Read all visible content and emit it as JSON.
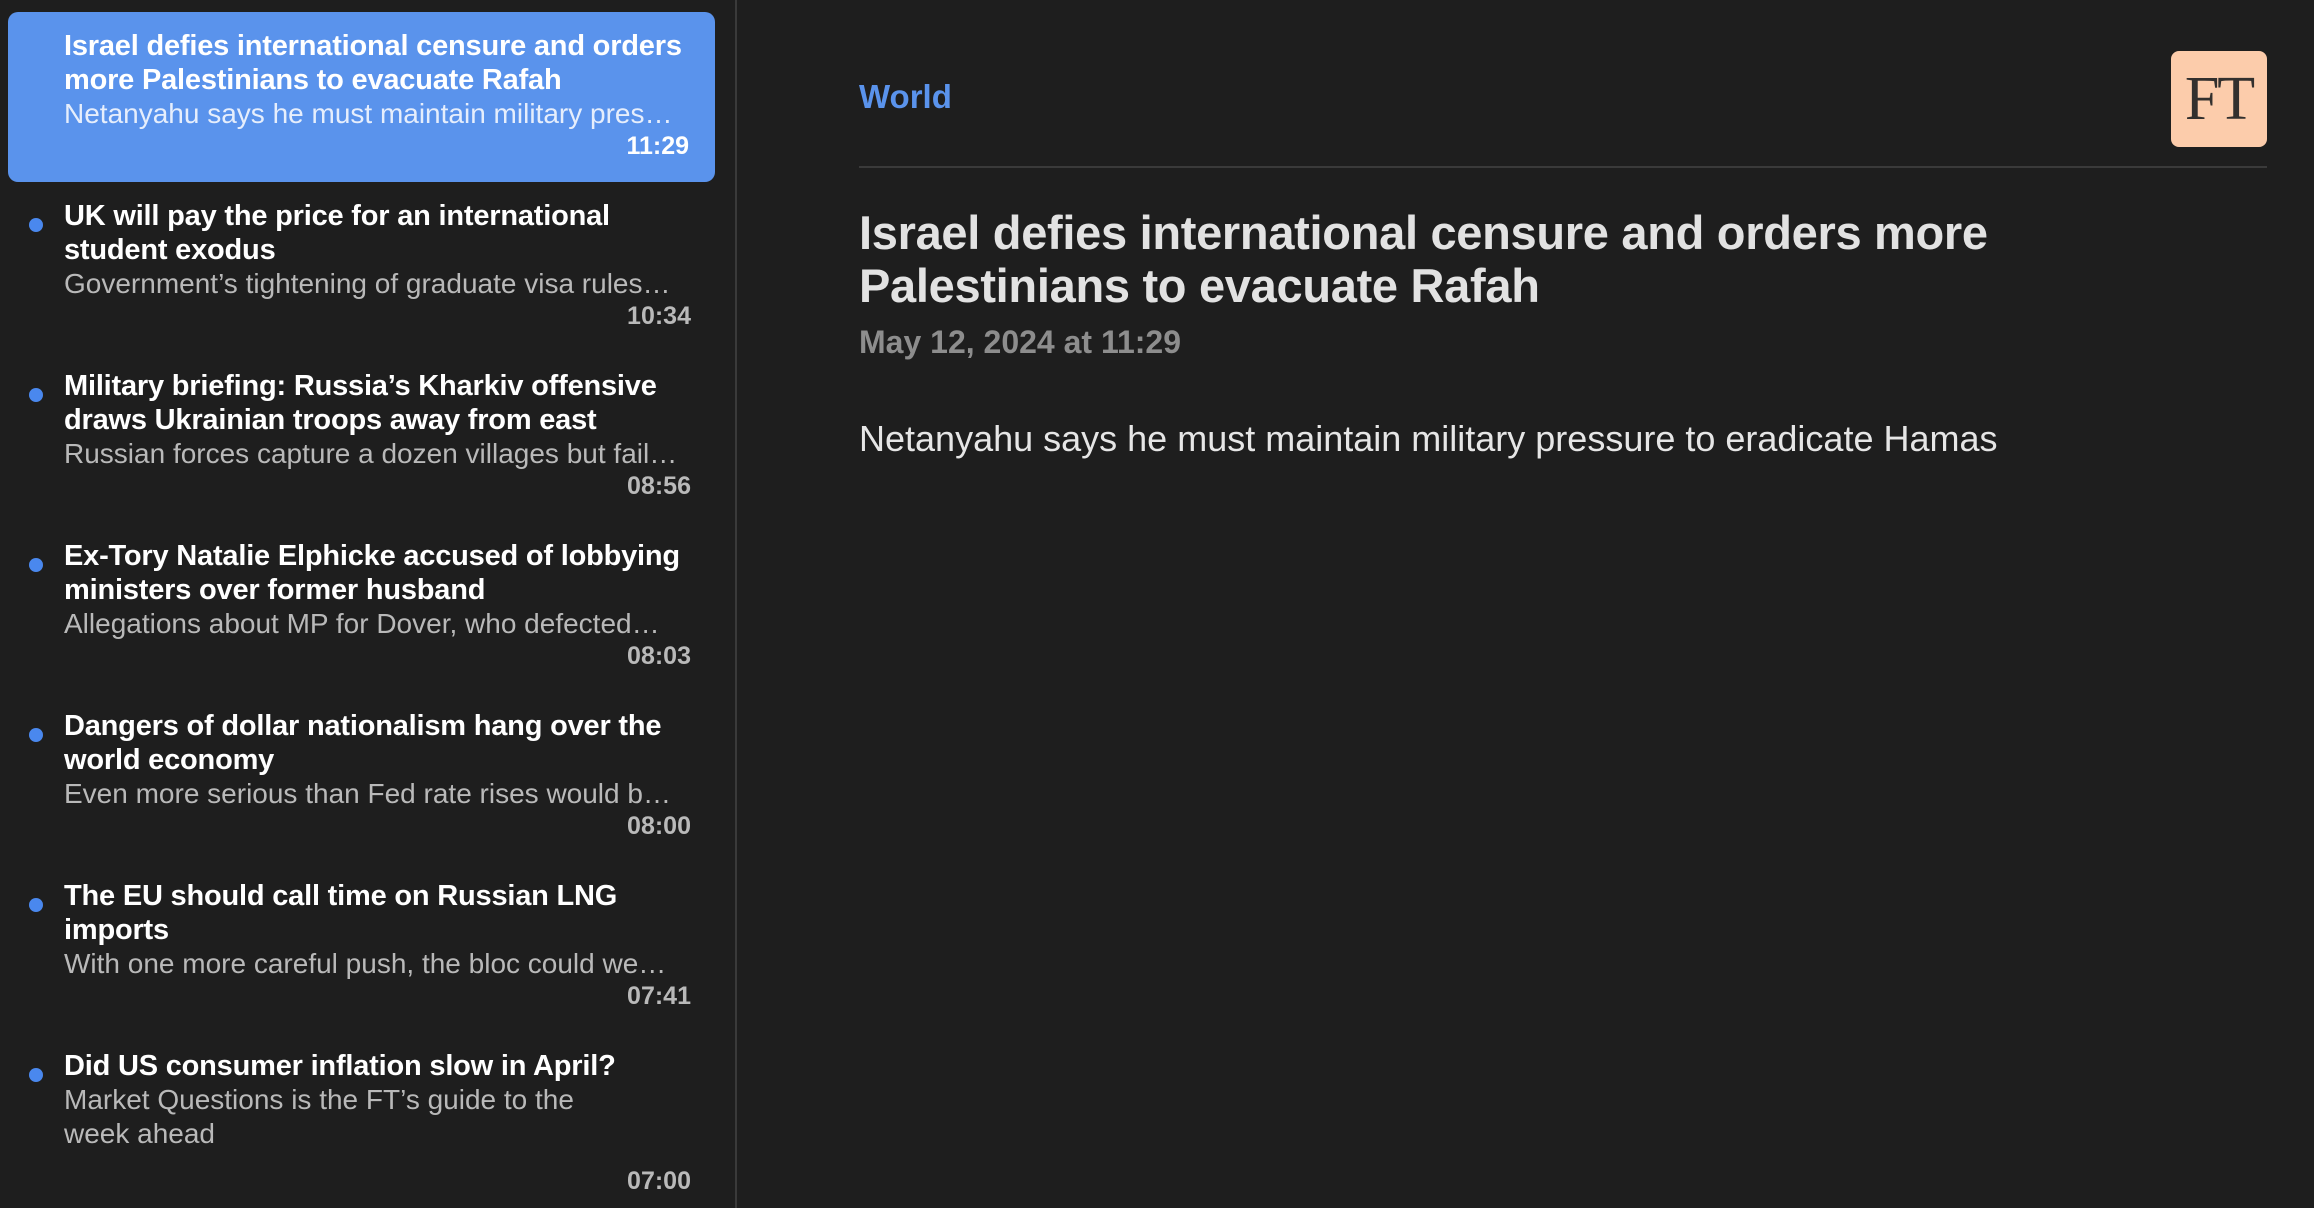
{
  "sidebar": {
    "articles": [
      {
        "title": "Israel defies international censure and orders more Palestinians to evacuate Rafah",
        "summary": "Netanyahu says he must maintain military pres…",
        "time": "11:29",
        "selected": true,
        "unread": false
      },
      {
        "title": "UK will pay the price for an international student exodus",
        "summary": "Government’s tightening of graduate visa rules…",
        "time": "10:34",
        "selected": false,
        "unread": true
      },
      {
        "title": "Military briefing: Russia’s Kharkiv offensive draws Ukrainian troops away from east",
        "summary": "Russian forces capture a dozen villages but fail…",
        "time": "08:56",
        "selected": false,
        "unread": true
      },
      {
        "title": "Ex-Tory Natalie Elphicke accused of lobbying ministers over former husband",
        "summary": "Allegations about MP for Dover, who defected…",
        "time": "08:03",
        "selected": false,
        "unread": true
      },
      {
        "title": "Dangers of dollar nationalism hang over the world economy",
        "summary": "Even more serious than Fed rate rises would b…",
        "time": "08:00",
        "selected": false,
        "unread": true
      },
      {
        "title": "The EU should call time on Russian LNG imports",
        "summary": "With one more careful push, the bloc could we…",
        "time": "07:41",
        "selected": false,
        "unread": true
      },
      {
        "title": "Did US consumer inflation slow in April?",
        "summary": "Market Questions is the FT’s guide to the week ahead",
        "time": "07:00",
        "selected": false,
        "unread": true
      }
    ]
  },
  "reader": {
    "section": "World",
    "logo_text": "FT",
    "headline": "Israel defies international censure and orders more Palestinians to evacuate Rafah",
    "date": "May 12, 2024 at 11:29",
    "standfirst": "Netanyahu says he must maintain military pressure to eradicate Hamas"
  },
  "colors": {
    "accent": "#5a93ec",
    "unread_dot": "#4a88ee",
    "background": "#1e1e1e",
    "logo_background": "#fcccab"
  },
  "icons": {
    "unread": "unread-dot-icon",
    "logo": "ft-logo"
  }
}
